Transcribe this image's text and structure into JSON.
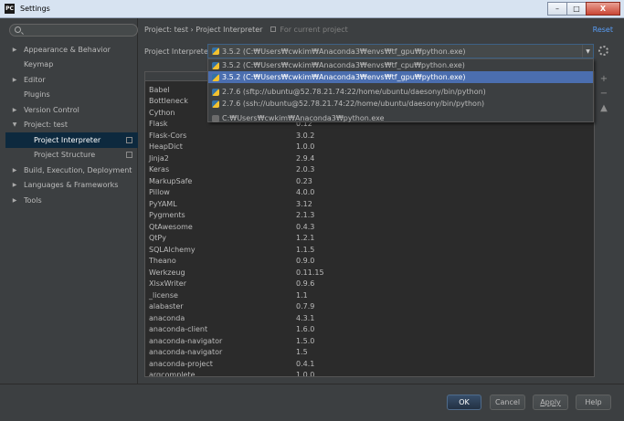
{
  "window": {
    "title": "Settings",
    "app_icon_text": "PC",
    "minimize": "–",
    "maximize": "□",
    "close": "X"
  },
  "search": {
    "placeholder": ""
  },
  "sidebar": {
    "items": [
      {
        "label": "Appearance & Behavior",
        "arrow": "▶"
      },
      {
        "label": "Keymap",
        "arrow": ""
      },
      {
        "label": "Editor",
        "arrow": "▶"
      },
      {
        "label": "Plugins",
        "arrow": ""
      },
      {
        "label": "Version Control",
        "arrow": "▶"
      },
      {
        "label": "Project: test",
        "arrow": "▼"
      },
      {
        "label": "Project Interpreter",
        "arrow": ""
      },
      {
        "label": "Project Structure",
        "arrow": ""
      },
      {
        "label": "Build, Execution, Deployment",
        "arrow": "▶"
      },
      {
        "label": "Languages & Frameworks",
        "arrow": "▶"
      },
      {
        "label": "Tools",
        "arrow": "▶"
      }
    ]
  },
  "header": {
    "breadcrumb": "Project: test › Project Interpreter",
    "for_current_project": "For current project",
    "reset": "Reset"
  },
  "interpreter": {
    "label": "Project Interpreter:",
    "selected": "3.5.2 (C:₩Users₩cwkim₩Anaconda3₩envs₩tf_gpu₩python.exe)",
    "dropdown_arrow": "▼",
    "options": [
      "3.5.2 (C:₩Users₩cwkim₩Anaconda3₩envs₩tf_cpu₩python.exe)",
      "3.5.2 (C:₩Users₩cwkim₩Anaconda3₩envs₩tf_gpu₩python.exe)",
      "2.7.6 (sftp://ubuntu@52.78.21.74:22/home/ubuntu/daesony/bin/python)",
      "2.7.6 (ssh://ubuntu@52.78.21.74:22/home/ubuntu/daesony/bin/python)",
      "C:₩Users₩cwkim₩Anaconda3₩python.exe"
    ]
  },
  "tools": {
    "add": "+",
    "remove": "−",
    "upgrade": "▲"
  },
  "packages": [
    {
      "name": "Babel",
      "version": ""
    },
    {
      "name": "Bottleneck",
      "version": ""
    },
    {
      "name": "Cython",
      "version": ""
    },
    {
      "name": "Flask",
      "version": "0.12"
    },
    {
      "name": "Flask-Cors",
      "version": "3.0.2"
    },
    {
      "name": "HeapDict",
      "version": "1.0.0"
    },
    {
      "name": "Jinja2",
      "version": "2.9.4"
    },
    {
      "name": "Keras",
      "version": "2.0.3"
    },
    {
      "name": "MarkupSafe",
      "version": "0.23"
    },
    {
      "name": "Pillow",
      "version": "4.0.0"
    },
    {
      "name": "PyYAML",
      "version": "3.12"
    },
    {
      "name": "Pygments",
      "version": "2.1.3"
    },
    {
      "name": "QtAwesome",
      "version": "0.4.3"
    },
    {
      "name": "QtPy",
      "version": "1.2.1"
    },
    {
      "name": "SQLAlchemy",
      "version": "1.1.5"
    },
    {
      "name": "Theano",
      "version": "0.9.0"
    },
    {
      "name": "Werkzeug",
      "version": "0.11.15"
    },
    {
      "name": "XlsxWriter",
      "version": "0.9.6"
    },
    {
      "name": "_license",
      "version": "1.1"
    },
    {
      "name": "alabaster",
      "version": "0.7.9"
    },
    {
      "name": "anaconda",
      "version": "4.3.1"
    },
    {
      "name": "anaconda-client",
      "version": "1.6.0"
    },
    {
      "name": "anaconda-navigator",
      "version": "1.5.0"
    },
    {
      "name": "anaconda-navigator",
      "version": "1.5"
    },
    {
      "name": "anaconda-project",
      "version": "0.4.1"
    },
    {
      "name": "argcomplete",
      "version": "1.0.0"
    }
  ],
  "footer": {
    "ok": "OK",
    "cancel": "Cancel",
    "apply": "Apply",
    "help": "Help"
  }
}
